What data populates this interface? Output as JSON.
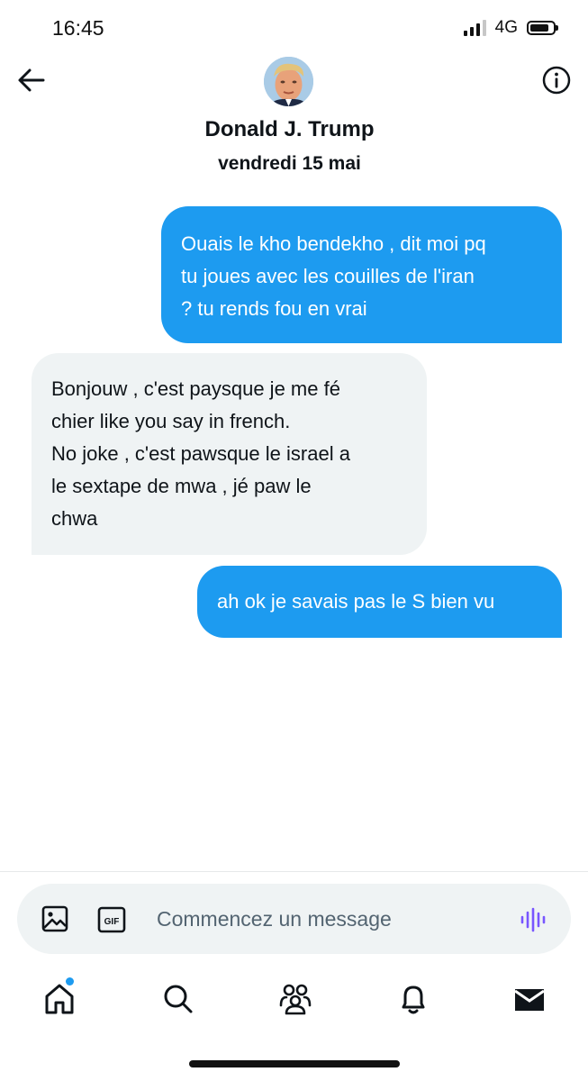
{
  "status_bar": {
    "time": "16:45",
    "network": "4G",
    "signal_bars_filled": 3,
    "signal_bars_total": 4
  },
  "header": {
    "contact_name": "Donald J. Trump",
    "date": "vendredi 15 mai",
    "back_icon": "back-arrow-icon",
    "info_icon": "info-icon"
  },
  "messages": [
    {
      "direction": "outgoing",
      "lines": [
        "Ouais le kho bendekho , dit moi pq",
        "tu joues avec les couilles de l'iran",
        "? tu rends fou en vrai"
      ]
    },
    {
      "direction": "incoming",
      "lines": [
        "Bonjouw , c'est paysque je me fé",
        "chier like you say in french.",
        "No joke , c'est pawsque le israel a",
        "le sextape de mwa , jé paw le",
        "chwa"
      ]
    },
    {
      "direction": "outgoing",
      "lines": [
        "ah ok je savais pas le S bien vu"
      ]
    }
  ],
  "composer": {
    "placeholder": "Commencez un message",
    "value": "",
    "gif_label": "GIF"
  },
  "nav": {
    "items": [
      "home-icon",
      "search-icon",
      "communities-icon",
      "notifications-icon",
      "messages-icon"
    ],
    "active": "messages-icon",
    "home_has_badge": true
  },
  "colors": {
    "outgoing_bubble": "#1d9bf0",
    "incoming_bubble": "#eff3f4",
    "voice_icon": "#7856ff"
  }
}
